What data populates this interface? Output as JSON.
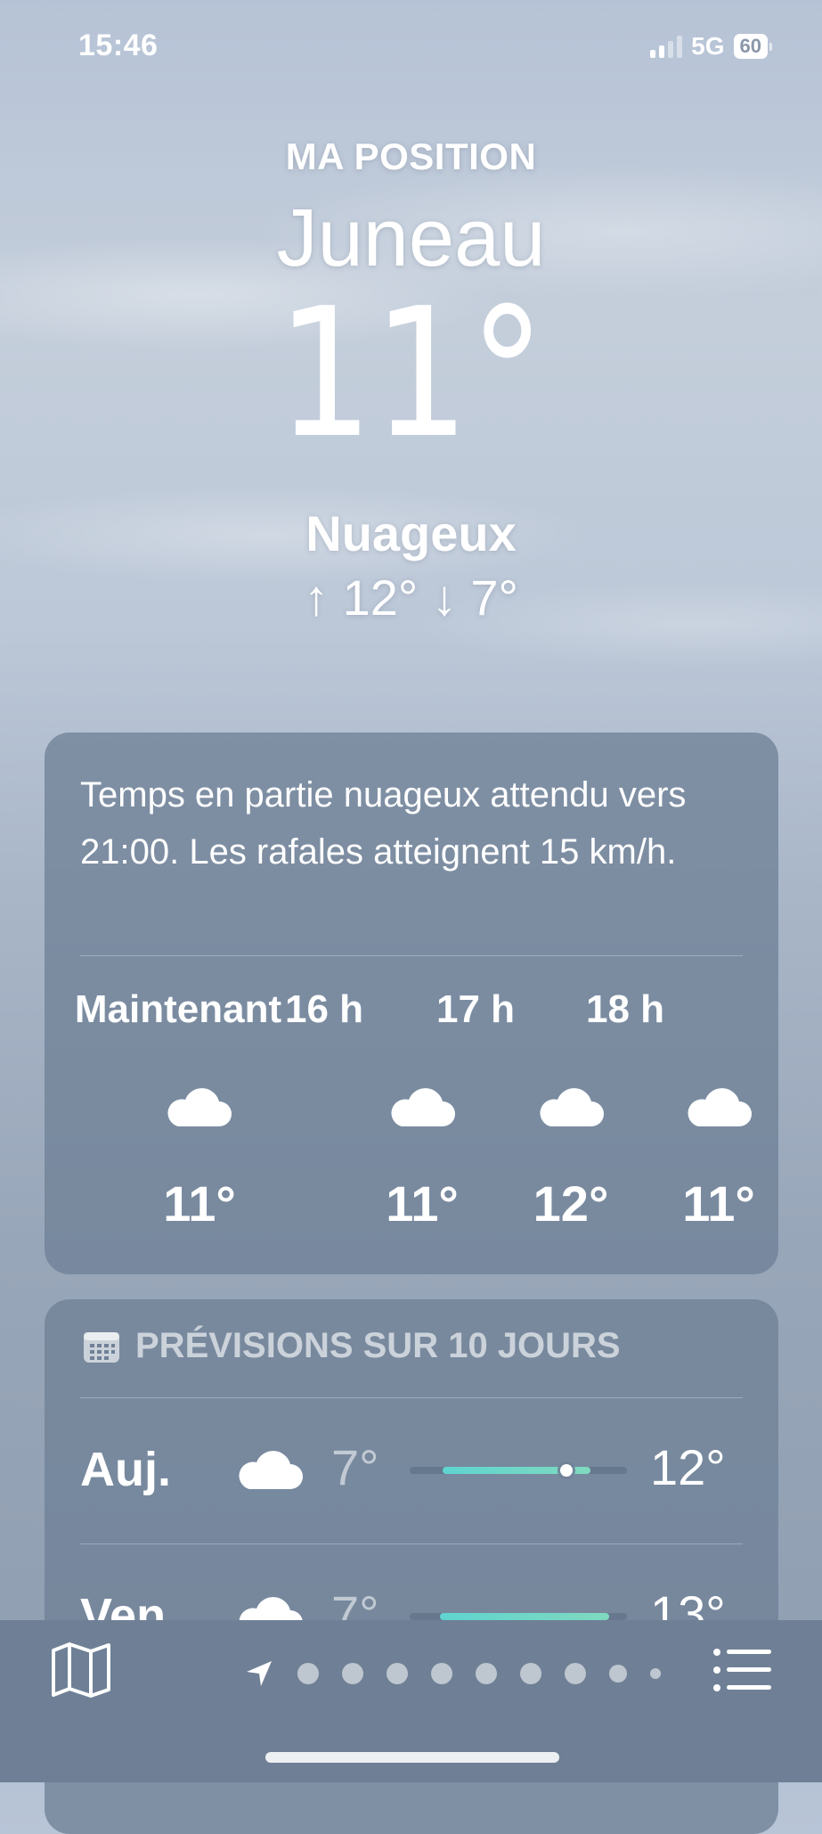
{
  "status_bar": {
    "time": "15:46",
    "network": "5G",
    "battery": "60"
  },
  "header": {
    "position_label": "MA POSITION",
    "city": "Juneau",
    "temperature": "11°",
    "condition": "Nuageux",
    "high_low": "↑ 12° ↓ 7°"
  },
  "hourly_card": {
    "summary": "Temps en partie nuageux attendu vers 21:00. Les rafales atteignent 15 km/h.",
    "hours": [
      {
        "label": "Maintenant",
        "icon": "cloud-icon",
        "temp": "11°"
      },
      {
        "label": "16 h",
        "icon": "cloud-icon",
        "temp": "11°"
      },
      {
        "label": "17 h",
        "icon": "cloud-icon",
        "temp": "12°"
      },
      {
        "label": "18 h",
        "icon": "cloud-icon",
        "temp": "11°"
      }
    ]
  },
  "forecast_card": {
    "title": "PRÉVISIONS SUR 10 JOURS",
    "icon": "calendar-icon",
    "days": [
      {
        "name": "Auj.",
        "icon": "cloud-icon",
        "low": "7°",
        "high": "12°",
        "range_start": 0.15,
        "range_end": 0.83,
        "current": 0.72
      },
      {
        "name": "Ven.",
        "icon": "cloud-icon",
        "low": "7°",
        "high": "13°",
        "range_start": 0.14,
        "range_end": 0.92
      }
    ]
  },
  "toolbar": {
    "left_icon": "map-icon",
    "right_icon": "list-icon",
    "location_icon": "location-arrow-icon",
    "page_count": 9,
    "current_page": 0,
    "colors": {
      "accent": "#5fd4d0",
      "toolbar": "#6f8096"
    }
  }
}
